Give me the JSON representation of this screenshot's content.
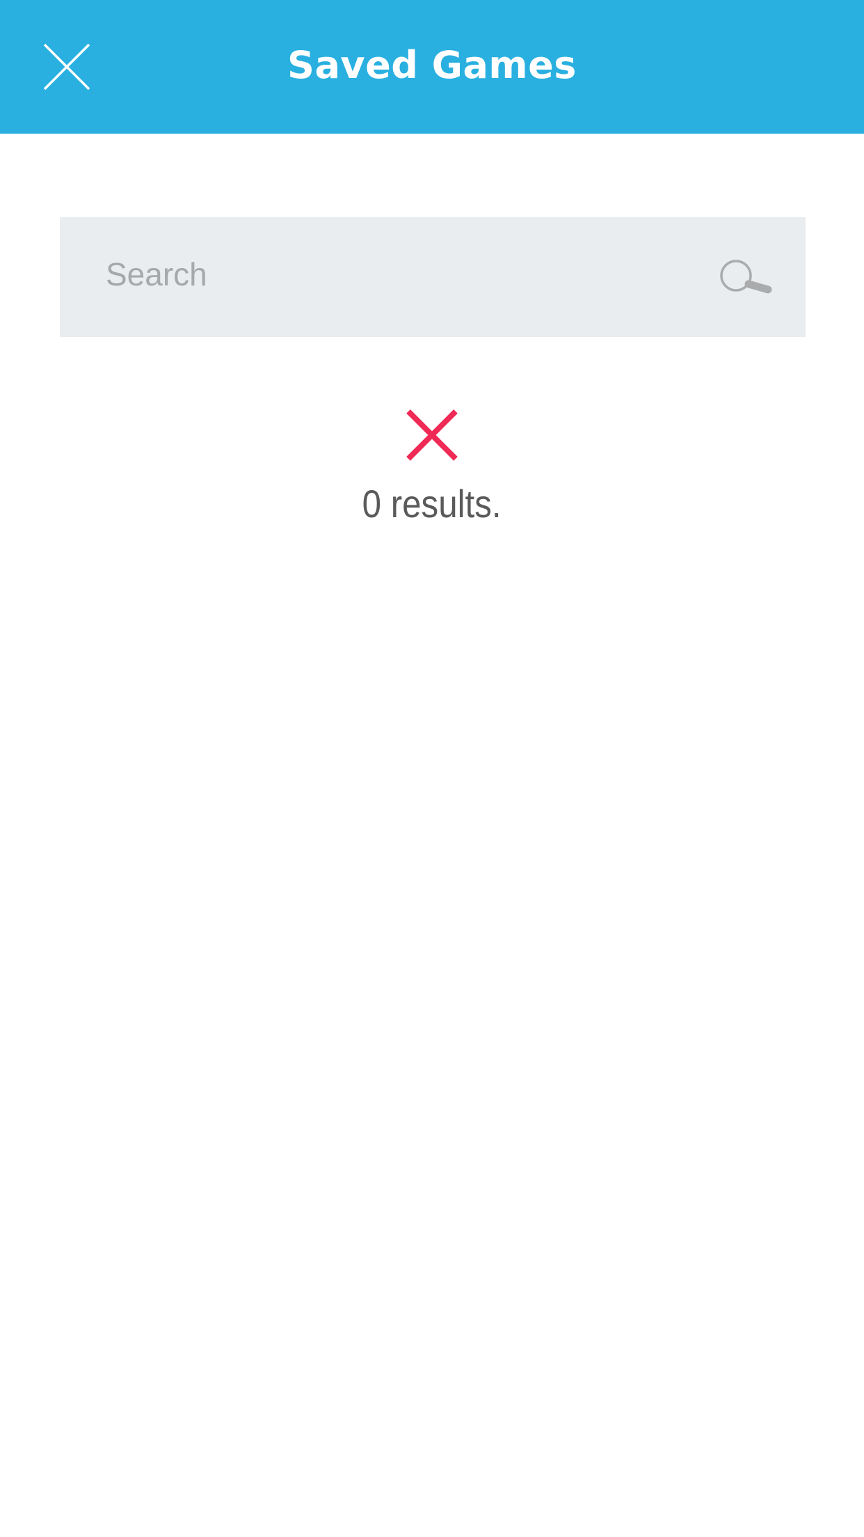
{
  "header": {
    "title": "Saved Games",
    "close_icon": "close-icon",
    "background_color": "#29b0e0"
  },
  "search": {
    "placeholder": "Search",
    "value": "",
    "icon": "search-icon",
    "background_color": "#e9edf0"
  },
  "results": {
    "icon": "error-x-icon",
    "icon_color": "#ee2a55",
    "message": "0 results."
  }
}
